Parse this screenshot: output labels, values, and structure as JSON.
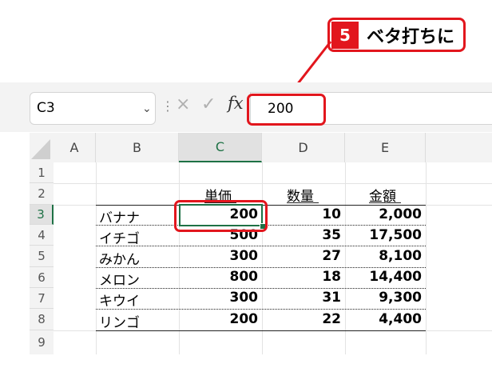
{
  "callout": {
    "step": "5",
    "text": "ベタ打ちに"
  },
  "name_box": {
    "value": "C3"
  },
  "formula_bar": {
    "cancel_icon": "×",
    "enter_icon": "✓",
    "fx_label": "fx",
    "value": "200"
  },
  "columns": [
    "A",
    "B",
    "C",
    "D",
    "E"
  ],
  "rows": [
    "1",
    "2",
    "3",
    "4",
    "5",
    "6",
    "7",
    "8",
    "9"
  ],
  "table": {
    "headers": {
      "price": "単価",
      "qty": "数量",
      "amount": "金額"
    },
    "items": [
      {
        "name": "バナナ",
        "price": "200",
        "qty": "10",
        "amount": "2,000"
      },
      {
        "name": "イチゴ",
        "price": "500",
        "qty": "35",
        "amount": "17,500"
      },
      {
        "name": "みかん",
        "price": "300",
        "qty": "27",
        "amount": "8,100"
      },
      {
        "name": "メロン",
        "price": "800",
        "qty": "18",
        "amount": "14,400"
      },
      {
        "name": "キウイ",
        "price": "300",
        "qty": "31",
        "amount": "9,300"
      },
      {
        "name": "リンゴ",
        "price": "200",
        "qty": "22",
        "amount": "4,400"
      }
    ]
  },
  "colors": {
    "accent_red": "#e2161d",
    "excel_green": "#1e7145"
  }
}
